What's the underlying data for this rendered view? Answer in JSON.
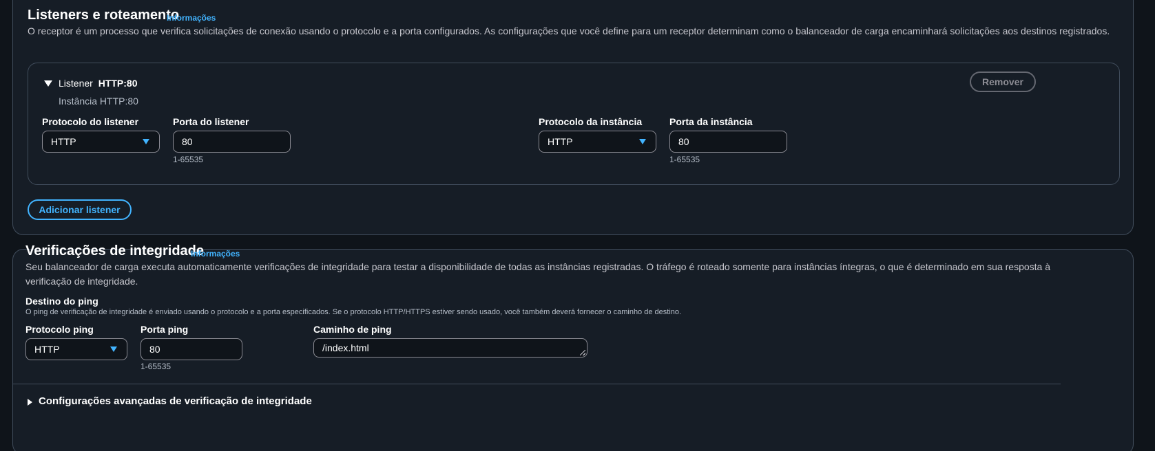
{
  "listeners": {
    "title": "Listeners e roteamento",
    "info": "Informações",
    "description": "O receptor é um processo que verifica solicitações de conexão usando o protocolo e a porta configurados. As configurações que você define para um receptor determinam como o balanceador de carga encaminhará solicitações aos destinos registrados.",
    "listener": {
      "prefix": "Listener",
      "name": "HTTP:80",
      "subtitle": "Instância HTTP:80",
      "remove_label": "Remover",
      "listener_protocol_label": "Protocolo do listener",
      "listener_protocol_value": "HTTP",
      "listener_port_label": "Porta do listener",
      "listener_port_value": "80",
      "listener_port_hint": "1-65535",
      "instance_protocol_label": "Protocolo da instância",
      "instance_protocol_value": "HTTP",
      "instance_port_label": "Porta da instância",
      "instance_port_value": "80",
      "instance_port_hint": "1-65535"
    },
    "add_label": "Adicionar listener"
  },
  "health": {
    "title": "Verificações de integridade",
    "info": "Informações",
    "description": "Seu balanceador de carga executa automaticamente verificações de integridade para testar a disponibilidade de todas as instâncias registradas. O tráfego é roteado somente para instâncias íntegras, o que é determinado em sua resposta à verificação de integridade.",
    "ping_target_label": "Destino do ping",
    "ping_target_hint": "O ping de verificação de integridade é enviado usando o protocolo e a porta especificados. Se o protocolo HTTP/HTTPS estiver sendo usado, você também deverá fornecer o caminho de destino.",
    "ping_protocol_label": "Protocolo ping",
    "ping_protocol_value": "HTTP",
    "ping_port_label": "Porta ping",
    "ping_port_value": "80",
    "ping_port_hint": "1-65535",
    "ping_path_label": "Caminho de ping",
    "ping_path_value": "/index.html",
    "advanced_label": "Configurações avançadas de verificação de integridade"
  },
  "colors": {
    "background": "#0f141a",
    "panel": "#161d26",
    "accent": "#42b4ff",
    "border": "#414d5c"
  }
}
